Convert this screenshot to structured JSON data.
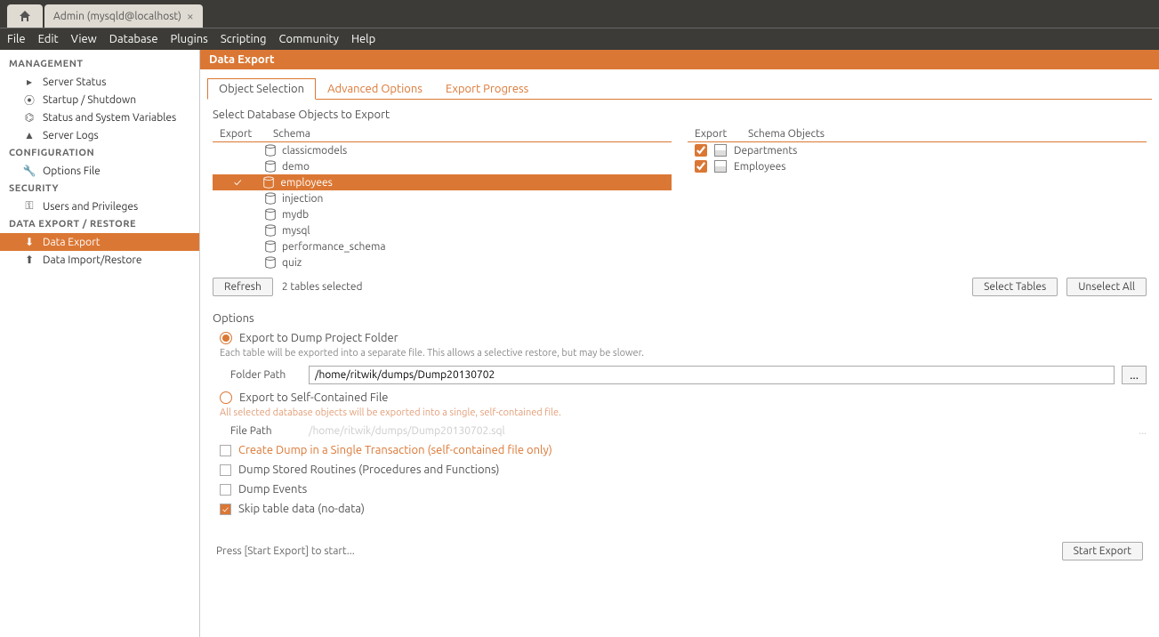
{
  "tab": {
    "title": "Admin (mysqld@localhost)"
  },
  "menu": [
    "File",
    "Edit",
    "View",
    "Database",
    "Plugins",
    "Scripting",
    "Community",
    "Help"
  ],
  "sidebar": {
    "sections": [
      {
        "title": "MANAGEMENT",
        "items": [
          "Server Status",
          "Startup / Shutdown",
          "Status and System Variables",
          "Server Logs"
        ],
        "icons": [
          "play-icon",
          "power-icon",
          "gauge-icon",
          "warning-icon"
        ]
      },
      {
        "title": "CONFIGURATION",
        "items": [
          "Options File"
        ],
        "icons": [
          "wrench-icon"
        ]
      },
      {
        "title": "SECURITY",
        "items": [
          "Users and Privileges"
        ],
        "icons": [
          "key-icon"
        ]
      },
      {
        "title": "DATA EXPORT / RESTORE",
        "items": [
          "Data Export",
          "Data Import/Restore"
        ],
        "icons": [
          "export-icon",
          "import-icon"
        ],
        "activeIndex": 0
      }
    ]
  },
  "main": {
    "title": "Data Export",
    "tabs": [
      "Object Selection",
      "Advanced Options",
      "Export Progress"
    ],
    "activeTab": 0,
    "instruction": "Select Database Objects to Export",
    "schemaHeader": {
      "export": "Export",
      "schema": "Schema"
    },
    "objectHeader": {
      "export": "Export",
      "schema": "Schema Objects"
    },
    "schemas": [
      "classicmodels",
      "demo",
      "employees",
      "injection",
      "mydb",
      "mysql",
      "performance_schema",
      "quiz"
    ],
    "selectedSchemaIndex": 2,
    "objects": [
      {
        "name": "Departments",
        "checked": true
      },
      {
        "name": "Employees",
        "checked": true
      }
    ],
    "refreshLabel": "Refresh",
    "selectedCount": "2 tables selected",
    "selectTablesLabel": "Select Tables",
    "unselectAllLabel": "Unselect All",
    "optionsTitle": "Options",
    "opt1": {
      "label": "Export to Dump Project Folder",
      "desc": "Each table will be exported into a separate file. This allows a selective restore, but may be slower.",
      "pathLabel": "Folder Path",
      "path": "/home/ritwik/dumps/Dump20130702"
    },
    "opt2": {
      "label": "Export to Self-Contained File",
      "desc": "All selected database objects will be exported into a single, self-contained file.",
      "pathLabel": "File Path",
      "path": "/home/ritwik/dumps/Dump20130702.sql"
    },
    "checks": [
      {
        "label": "Create Dump in a Single Transaction (self-contained file only)",
        "checked": false,
        "disabled": true
      },
      {
        "label": "Dump Stored Routines (Procedures and Functions)",
        "checked": false
      },
      {
        "label": "Dump Events",
        "checked": false
      },
      {
        "label": "Skip table data (no-data)",
        "checked": true
      }
    ],
    "footerText": "Press [Start Export] to start...",
    "startExportLabel": "Start Export",
    "browseBtn": "..."
  }
}
